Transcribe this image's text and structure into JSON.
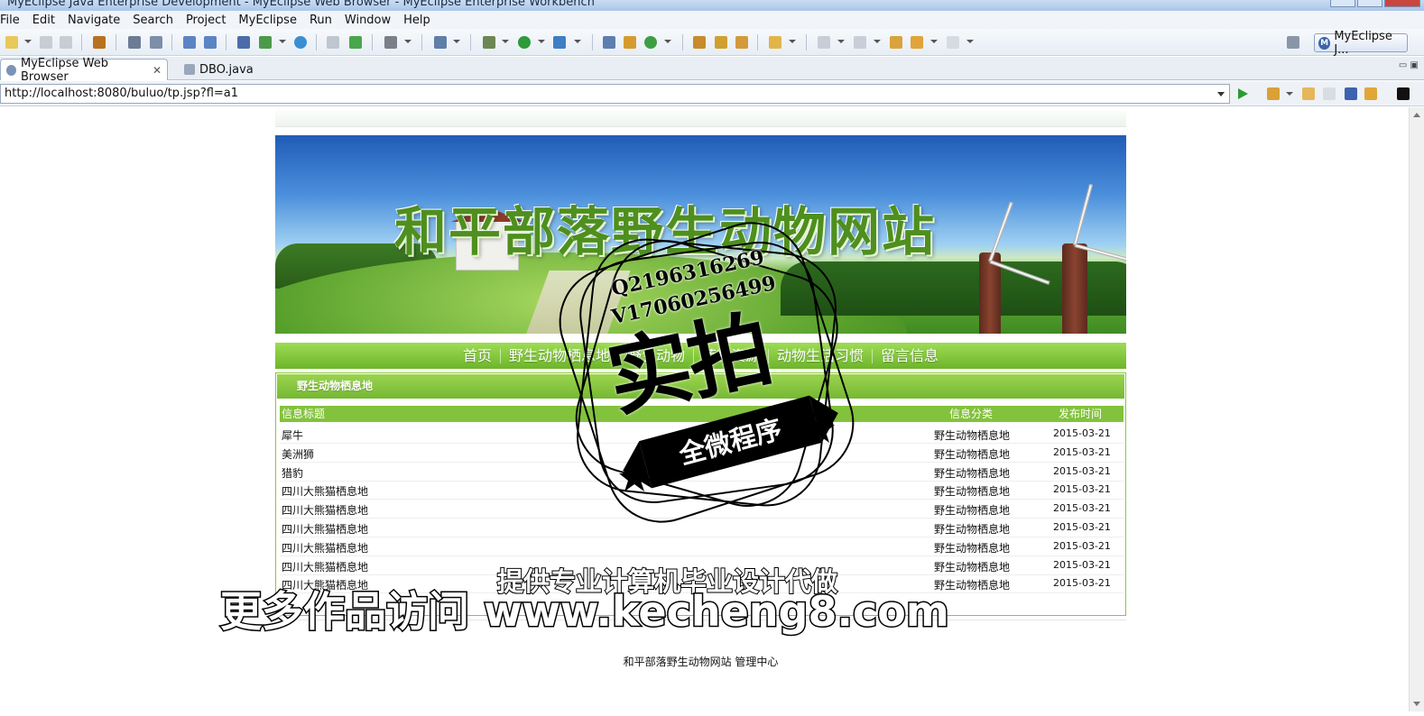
{
  "window": {
    "title": "MyEclipse Java Enterprise Development - MyEclipse Web Browser - MyEclipse Enterprise Workbench"
  },
  "menubar": {
    "items": [
      "File",
      "Edit",
      "Navigate",
      "Search",
      "Project",
      "MyEclipse",
      "Run",
      "Window",
      "Help"
    ]
  },
  "perspective": {
    "label": "MyEclipse J..."
  },
  "tabs": [
    {
      "label": "MyEclipse Web Browser",
      "active": true
    },
    {
      "label": "DBO.java",
      "active": false
    }
  ],
  "browser": {
    "url": "http://localhost:8080/buluo/tp.jsp?fl=a1"
  },
  "site": {
    "banner_title": "和平部落野生动物网站",
    "nav": [
      "首页",
      "野生动物栖息地",
      "野生动物",
      "药物资源",
      "动物生活习惯",
      "留言信息"
    ],
    "panel_title": "野生动物栖息地",
    "list_headers": {
      "title": "信息标题",
      "category": "信息分类",
      "date": "发布时间"
    },
    "rows": [
      {
        "title": "犀牛",
        "category": "野生动物栖息地",
        "date": "2015-03-21"
      },
      {
        "title": "美洲狮",
        "category": "野生动物栖息地",
        "date": "2015-03-21"
      },
      {
        "title": "猎豹",
        "category": "野生动物栖息地",
        "date": "2015-03-21"
      },
      {
        "title": "四川大熊猫栖息地",
        "category": "野生动物栖息地",
        "date": "2015-03-21"
      },
      {
        "title": "四川大熊猫栖息地",
        "category": "野生动物栖息地",
        "date": "2015-03-21"
      },
      {
        "title": "四川大熊猫栖息地",
        "category": "野生动物栖息地",
        "date": "2015-03-21"
      },
      {
        "title": "四川大熊猫栖息地",
        "category": "野生动物栖息地",
        "date": "2015-03-21"
      },
      {
        "title": "四川大熊猫栖息地",
        "category": "野生动物栖息地",
        "date": "2015-03-21"
      },
      {
        "title": "四川大熊猫栖息地",
        "category": "野生动物栖息地",
        "date": "2015-03-21"
      }
    ],
    "footer": "和平部落野生动物网站 管理中心"
  },
  "watermark": {
    "qq": "Q2196316269",
    "wechat": "V17060256499",
    "stamp_main": "实拍",
    "stamp_ribbon": "全微程序",
    "caption_top": "提供专业计算机毕业设计代做",
    "caption_bottom": "更多作品访问 www.kecheng8.com"
  },
  "colors": {
    "site_green": "#83c23c",
    "nav_green": "#6db52a",
    "title_green": "#4e8f1f"
  }
}
